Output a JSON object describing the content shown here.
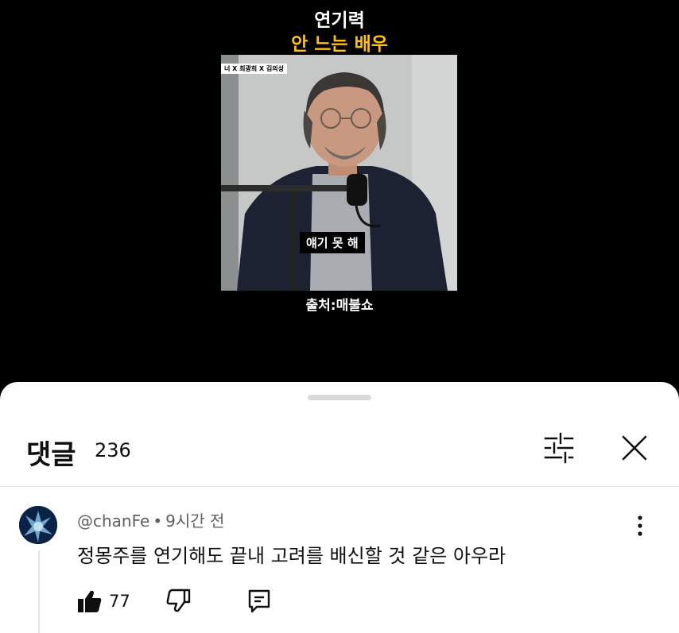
{
  "video": {
    "title_line1": "연기력",
    "title_line2": "안 느는 배우",
    "tag": "너 X 최광희 X 김의성",
    "subtitle": "얘기 못 해",
    "credit": "출처:매불쇼"
  },
  "comments": {
    "title": "댓글",
    "count": "236",
    "items": [
      {
        "author": "@chanFe",
        "separator": "•",
        "time": "9시간 전",
        "text": "정몽주를 연기해도 끝내 고려를 배신할 것 같은 아우라",
        "likes": "77"
      }
    ]
  },
  "icons": {
    "filter": "sliders-icon",
    "close": "close-icon",
    "more": "more-vertical-icon",
    "like": "thumbs-up-icon",
    "dislike": "thumbs-down-icon",
    "reply": "reply-icon"
  },
  "colors": {
    "background": "#000000",
    "title_highlight": "#ffc20e",
    "sheet": "#ffffff",
    "meta_text": "#606060"
  }
}
